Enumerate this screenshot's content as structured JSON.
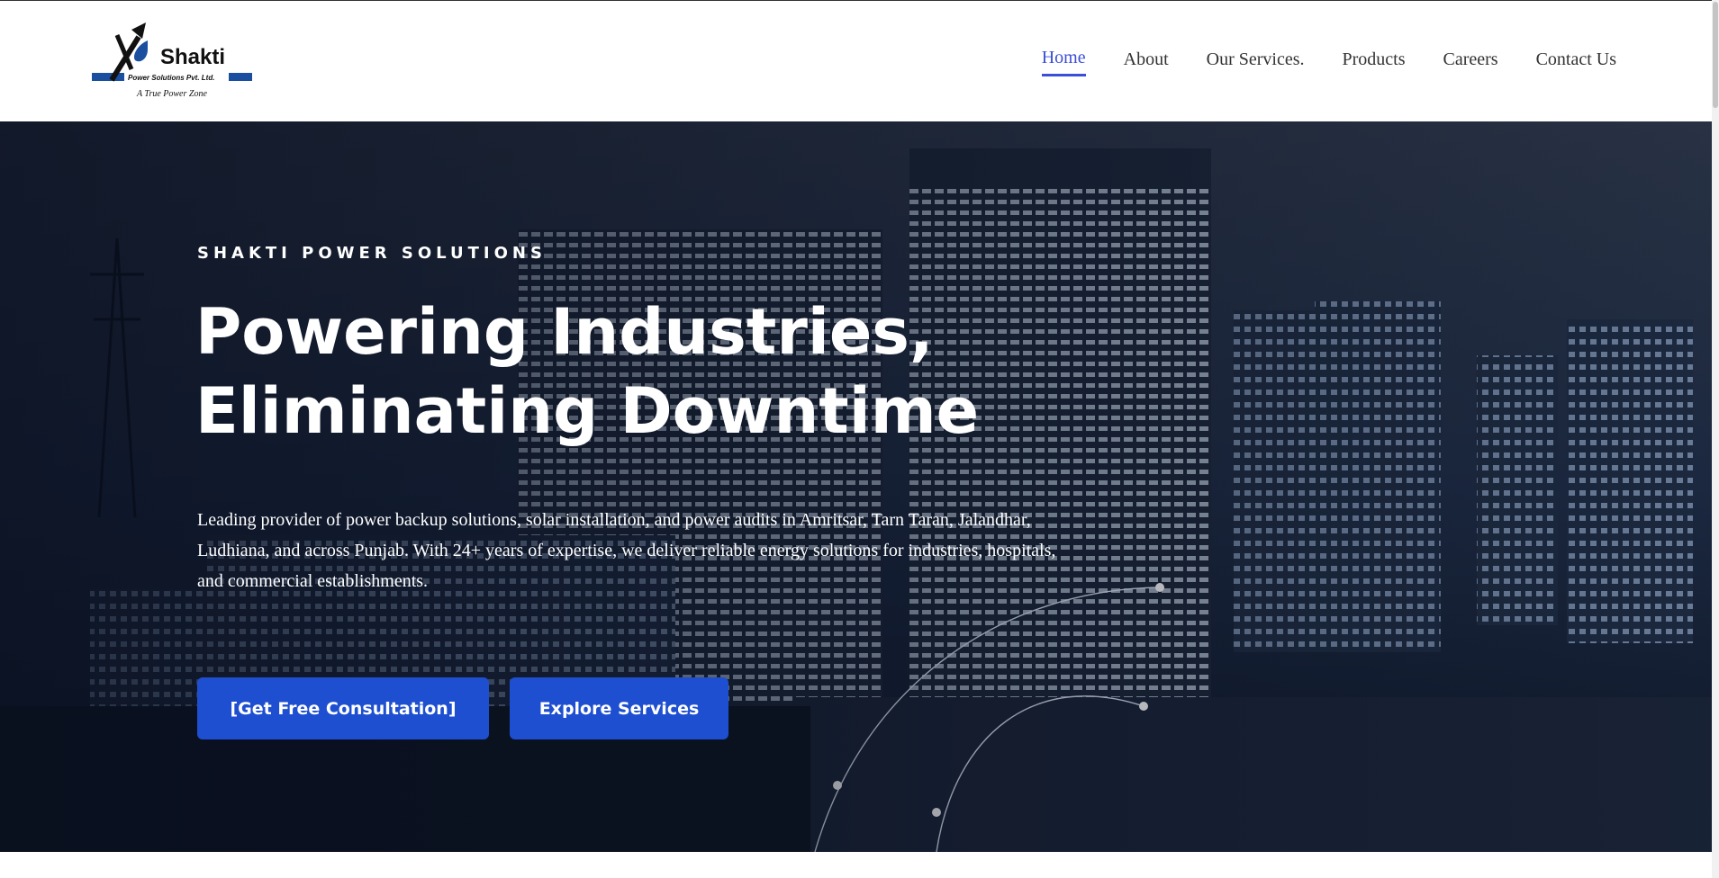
{
  "brand": {
    "name": "Shakti",
    "subtitle": "Power Solutions Pvt. Ltd.",
    "tagline": "A True Power Zone",
    "accent": "#1a4fa0"
  },
  "nav": {
    "items": [
      {
        "label": "Home",
        "active": true
      },
      {
        "label": "About"
      },
      {
        "label": "Our Services."
      },
      {
        "label": "Products"
      },
      {
        "label": "Careers"
      },
      {
        "label": "Contact Us"
      }
    ],
    "active_color": "#3b4fd6"
  },
  "hero": {
    "eyebrow": "SHAKTI POWER SOLUTIONS",
    "headline_line1": "Powering Industries,",
    "headline_line2": "Eliminating Downtime",
    "lead": "Leading provider of power backup solutions, solar installation, and power audits in Amritsar, Tarn Taran, Jalandhar, Ludhiana, and across Punjab. With 24+ years of expertise, we deliver reliable energy solutions for industries, hospitals, and commercial establishments.",
    "primary_button": "[Get Free Consultation]",
    "secondary_button": "Explore Services",
    "button_color": "#1e4fd0"
  }
}
